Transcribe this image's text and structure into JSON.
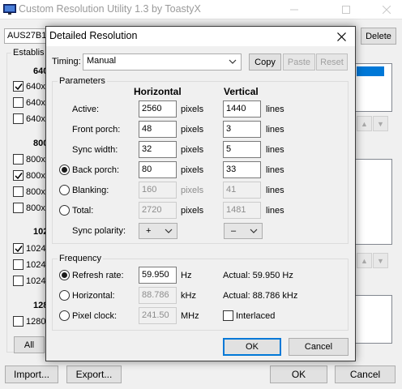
{
  "main": {
    "title": "Custom Resolution Utility 1.3 by ToastyX",
    "monitor_combo": "AUS27B1",
    "delete_label": "Delete",
    "established_label": "Establis",
    "left_sections": [
      {
        "header": "640",
        "items": [
          {
            "label": "640x",
            "checked": true
          },
          {
            "label": "640x",
            "checked": false
          },
          {
            "label": "640x",
            "checked": false
          }
        ]
      },
      {
        "header": "800",
        "items": [
          {
            "label": "800x",
            "checked": false
          },
          {
            "label": "800x",
            "checked": true
          },
          {
            "label": "800x",
            "checked": false
          },
          {
            "label": "800x",
            "checked": false
          }
        ]
      },
      {
        "header": "102",
        "items": [
          {
            "label": "1024",
            "checked": true
          },
          {
            "label": "1024",
            "checked": false
          },
          {
            "label": "1024",
            "checked": false
          }
        ]
      },
      {
        "header": "128",
        "items": [
          {
            "label": "1280",
            "checked": false
          }
        ]
      }
    ],
    "all_label": "All",
    "import_label": "Import...",
    "export_label": "Export...",
    "ok_label": "OK",
    "cancel_label": "Cancel"
  },
  "dialog": {
    "title": "Detailed Resolution",
    "timing_label": "Timing:",
    "timing_value": "Manual",
    "copy_label": "Copy",
    "paste_label": "Paste",
    "reset_label": "Reset",
    "parameters": {
      "group_label": "Parameters",
      "horizontal_header": "Horizontal",
      "vertical_header": "Vertical",
      "rows": [
        {
          "label": "Active:",
          "h": "2560",
          "h_unit": "pixels",
          "v": "1440",
          "v_unit": "lines"
        },
        {
          "label": "Front porch:",
          "h": "48",
          "h_unit": "pixels",
          "v": "3",
          "v_unit": "lines"
        },
        {
          "label": "Sync width:",
          "h": "32",
          "h_unit": "pixels",
          "v": "5",
          "v_unit": "lines"
        },
        {
          "label": "Back porch:",
          "h": "80",
          "h_unit": "pixels",
          "v": "33",
          "v_unit": "lines"
        },
        {
          "label": "Blanking:",
          "h": "160",
          "h_unit": "pixels",
          "v": "41",
          "v_unit": "lines"
        },
        {
          "label": "Total:",
          "h": "2720",
          "h_unit": "pixels",
          "v": "1481",
          "v_unit": "lines"
        }
      ],
      "sync_polarity_label": "Sync polarity:",
      "h_polarity": "+",
      "v_polarity": "–"
    },
    "frequency": {
      "group_label": "Frequency",
      "refresh_label": "Refresh rate:",
      "refresh_value": "59.950",
      "refresh_unit": "Hz",
      "refresh_actual": "Actual: 59.950 Hz",
      "horizontal_label": "Horizontal:",
      "horizontal_value": "88.786",
      "horizontal_unit": "kHz",
      "horizontal_actual": "Actual: 88.786 kHz",
      "pixel_clock_label": "Pixel clock:",
      "pixel_clock_value": "241.50",
      "pixel_clock_unit": "MHz",
      "interlaced_label": "Interlaced"
    },
    "ok_label": "OK",
    "cancel_label": "Cancel"
  }
}
